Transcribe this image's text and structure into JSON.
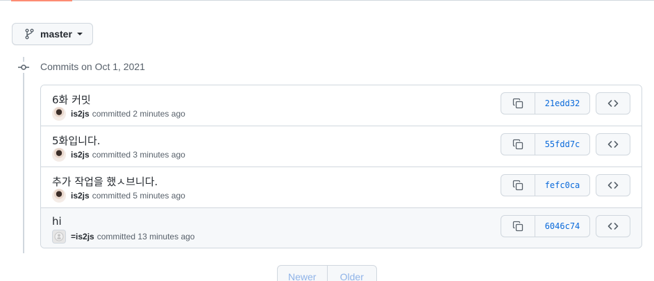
{
  "branch": {
    "label": "master",
    "icon": "git-branch-icon"
  },
  "group": {
    "title": "Commits on Oct 1, 2021"
  },
  "commits": [
    {
      "title": "6화 커밋",
      "author": "is2js",
      "action": "committed",
      "time": "2 minutes ago",
      "sha": "21edd32",
      "avatar": "photo"
    },
    {
      "title": "5화입니다.",
      "author": "is2js",
      "action": "committed",
      "time": "3 minutes ago",
      "sha": "55fdd7c",
      "avatar": "photo"
    },
    {
      "title": "추가 작업을 했ㅅ브니다.",
      "author": "is2js",
      "action": "committed",
      "time": "5 minutes ago",
      "sha": "fefc0ca",
      "avatar": "photo"
    },
    {
      "title": "hi",
      "author": "=is2js",
      "action": "committed",
      "time": "13 minutes ago",
      "sha": "6046c74",
      "avatar": "default"
    }
  ],
  "pagination": {
    "newer": "Newer",
    "older": "Older"
  },
  "colors": {
    "accent": "#fd8c73",
    "link": "#0969da",
    "border": "#d0d7de",
    "disabled": "#8fb3e8"
  }
}
